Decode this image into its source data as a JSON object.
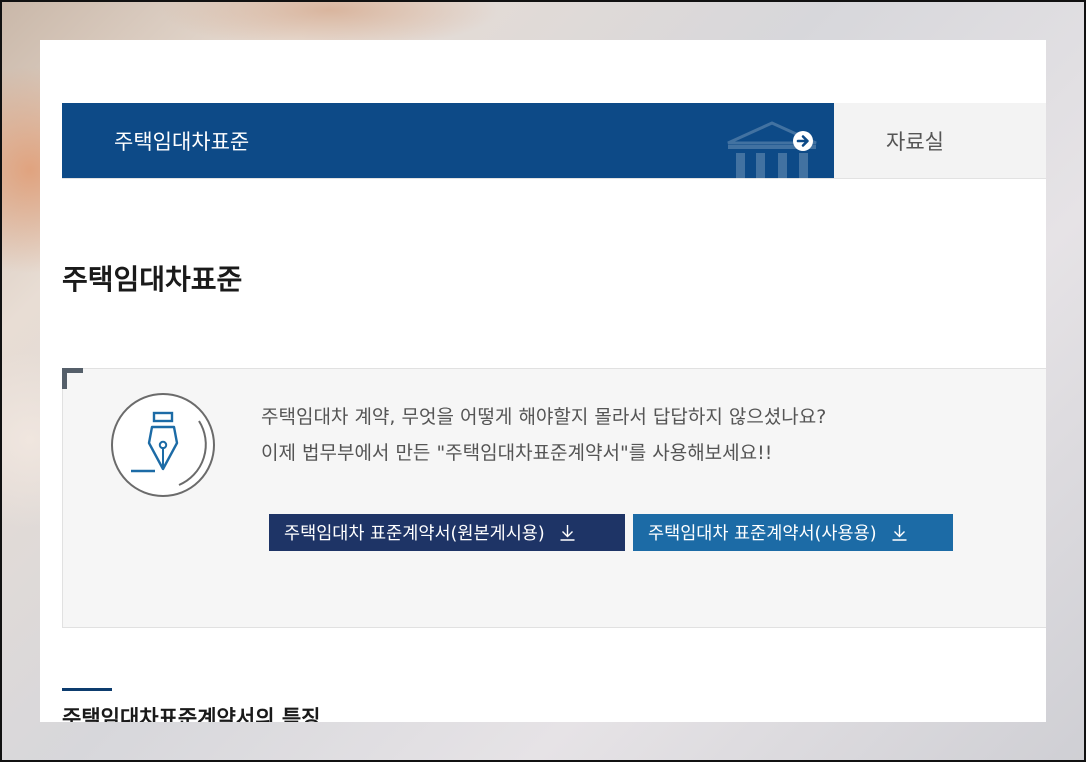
{
  "tabs": [
    {
      "label": "주택임대차표준",
      "active": true
    },
    {
      "label": "자료실",
      "active": false
    }
  ],
  "page_title": "주택임대차표준",
  "info": {
    "line1": "주택임대차 계약, 무엇을 어떻게 해야할지 몰라서 답답하지 않으셨나요?",
    "line2": "이제 법무부에서 만든 \"주택임대차표준계약서\"를 사용해보세요!!",
    "icon": "fountain-pen-icon"
  },
  "buttons": [
    {
      "label": "주택임대차 표준계약서(원본게시용)",
      "icon": "download-icon",
      "color": "#1e3466"
    },
    {
      "label": "주택임대차 표준계약서(사용용)",
      "icon": "download-icon",
      "color": "#1c6ba6"
    }
  ],
  "section_title": "주택임대차표준계약서의 특징",
  "colors": {
    "primary": "#0d4a87",
    "dark_button": "#1e3466",
    "blue_button": "#1c6ba6"
  }
}
